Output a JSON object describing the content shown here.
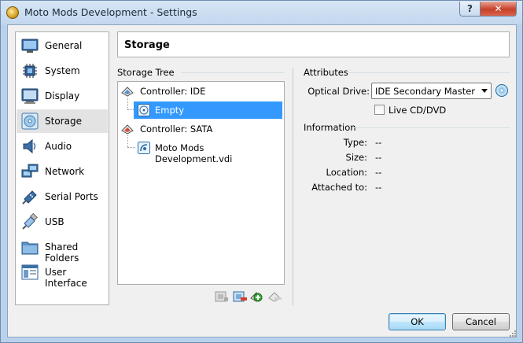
{
  "window": {
    "title": "Moto Mods Development - Settings",
    "help_label": "?",
    "close_label": "✕"
  },
  "sidebar": {
    "items": [
      {
        "label": "General",
        "icon": "general-icon"
      },
      {
        "label": "System",
        "icon": "system-icon"
      },
      {
        "label": "Display",
        "icon": "display-icon"
      },
      {
        "label": "Storage",
        "icon": "storage-icon"
      },
      {
        "label": "Audio",
        "icon": "audio-icon"
      },
      {
        "label": "Network",
        "icon": "network-icon"
      },
      {
        "label": "Serial Ports",
        "icon": "serial-ports-icon"
      },
      {
        "label": "USB",
        "icon": "usb-icon"
      },
      {
        "label": "Shared Folders",
        "icon": "shared-folders-icon"
      },
      {
        "label": "User Interface",
        "icon": "user-interface-icon"
      }
    ],
    "selected": "Storage"
  },
  "page": {
    "title": "Storage"
  },
  "storage_tree": {
    "label": "Storage Tree",
    "controllers": [
      {
        "label": "Controller: IDE",
        "devices": [
          {
            "label": "Empty",
            "selected": true
          }
        ]
      },
      {
        "label": "Controller: SATA",
        "devices": [
          {
            "label": "Moto Mods Development.vdi",
            "selected": false
          }
        ]
      }
    ]
  },
  "attributes": {
    "label": "Attributes",
    "optical_drive_label": "Optical Drive:",
    "optical_drive_value": "IDE Secondary Master",
    "live_cd_label": "Live CD/DVD",
    "live_cd_checked": false
  },
  "information": {
    "label": "Information",
    "rows": [
      {
        "label": "Type:",
        "value": "--"
      },
      {
        "label": "Size:",
        "value": "--"
      },
      {
        "label": "Location:",
        "value": "--"
      },
      {
        "label": "Attached to:",
        "value": "--"
      }
    ]
  },
  "buttons": {
    "ok": "OK",
    "cancel": "Cancel"
  },
  "colors": {
    "selection": "#3399ff",
    "title_bar": "#c2d7ee"
  }
}
